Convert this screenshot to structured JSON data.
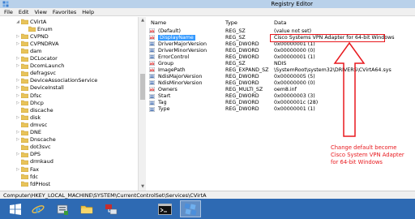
{
  "window": {
    "title": "Registry Editor"
  },
  "menu": [
    "File",
    "Edit",
    "View",
    "Favorites",
    "Help"
  ],
  "tree": [
    {
      "label": "CVirtA",
      "indent": 2,
      "expander": "◢",
      "open": true
    },
    {
      "label": "Enum",
      "indent": 3,
      "expander": "",
      "open": false
    },
    {
      "label": "CVPND",
      "indent": 2,
      "expander": "▷",
      "open": false
    },
    {
      "label": "CVPNDRVA",
      "indent": 2,
      "expander": "▷",
      "open": false
    },
    {
      "label": "dam",
      "indent": 2,
      "expander": "",
      "open": false
    },
    {
      "label": "DCLocator",
      "indent": 2,
      "expander": "▷",
      "open": false
    },
    {
      "label": "DcomLaunch",
      "indent": 2,
      "expander": "▷",
      "open": false
    },
    {
      "label": "defragsvc",
      "indent": 2,
      "expander": "",
      "open": false
    },
    {
      "label": "DeviceAssociationService",
      "indent": 2,
      "expander": "▷",
      "open": false
    },
    {
      "label": "DeviceInstall",
      "indent": 2,
      "expander": "▷",
      "open": false
    },
    {
      "label": "Dfsc",
      "indent": 2,
      "expander": "▷",
      "open": false
    },
    {
      "label": "Dhcp",
      "indent": 2,
      "expander": "▷",
      "open": false
    },
    {
      "label": "discache",
      "indent": 2,
      "expander": "",
      "open": false
    },
    {
      "label": "disk",
      "indent": 2,
      "expander": "▷",
      "open": false
    },
    {
      "label": "dmvsc",
      "indent": 2,
      "expander": "",
      "open": false
    },
    {
      "label": "DNE",
      "indent": 2,
      "expander": "▷",
      "open": false
    },
    {
      "label": "Dnscache",
      "indent": 2,
      "expander": "▷",
      "open": false
    },
    {
      "label": "dot3svc",
      "indent": 2,
      "expander": "",
      "open": false
    },
    {
      "label": "DPS",
      "indent": 2,
      "expander": "▷",
      "open": false
    },
    {
      "label": "drmkaud",
      "indent": 2,
      "expander": "",
      "open": false
    },
    {
      "label": "Fax",
      "indent": 2,
      "expander": "▷",
      "open": false
    },
    {
      "label": "fdc",
      "indent": 2,
      "expander": "",
      "open": false
    },
    {
      "label": "fdPHost",
      "indent": 2,
      "expander": "",
      "open": false
    }
  ],
  "list": {
    "headers": {
      "name": "Name",
      "type": "Type",
      "data": "Data"
    },
    "rows": [
      {
        "name": "(Default)",
        "type": "REG_SZ",
        "data": "(value not set)",
        "kind": "sz",
        "selected": false
      },
      {
        "name": "DisplayName",
        "type": "REG_SZ",
        "data": "Cisco Systems VPN Adapter for 64-bit Windows",
        "kind": "sz",
        "selected": true
      },
      {
        "name": "DriverMajorVersion",
        "type": "REG_DWORD",
        "data": "0x00000001 (1)",
        "kind": "dword",
        "selected": false
      },
      {
        "name": "DriverMinorVersion",
        "type": "REG_DWORD",
        "data": "0x00000000 (0)",
        "kind": "dword",
        "selected": false
      },
      {
        "name": "ErrorControl",
        "type": "REG_DWORD",
        "data": "0x00000001 (1)",
        "kind": "dword",
        "selected": false
      },
      {
        "name": "Group",
        "type": "REG_SZ",
        "data": "NDIS",
        "kind": "sz",
        "selected": false
      },
      {
        "name": "ImagePath",
        "type": "REG_EXPAND_SZ",
        "data": "\\SystemRoot\\system32\\DRIVERS\\CVirtA64.sys",
        "kind": "sz",
        "selected": false
      },
      {
        "name": "NdisMajorVersion",
        "type": "REG_DWORD",
        "data": "0x00000005 (5)",
        "kind": "dword",
        "selected": false
      },
      {
        "name": "NdisMinorVersion",
        "type": "REG_DWORD",
        "data": "0x00000000 (0)",
        "kind": "dword",
        "selected": false
      },
      {
        "name": "Owners",
        "type": "REG_MULTI_SZ",
        "data": "oem8.inf",
        "kind": "sz",
        "selected": false
      },
      {
        "name": "Start",
        "type": "REG_DWORD",
        "data": "0x00000003 (3)",
        "kind": "dword",
        "selected": false
      },
      {
        "name": "Tag",
        "type": "REG_DWORD",
        "data": "0x0000001c (28)",
        "kind": "dword",
        "selected": false
      },
      {
        "name": "Type",
        "type": "REG_DWORD",
        "data": "0x00000001 (1)",
        "kind": "dword",
        "selected": false
      }
    ]
  },
  "annotation": {
    "text": "Change default become Cisco System VPN Adapter for 64-bit Windows"
  },
  "statusbar": {
    "path": "Computer\\HKEY_LOCAL_MACHINE\\SYSTEM\\CurrentControlSet\\Services\\CVirtA"
  },
  "taskbar": {
    "items": [
      {
        "icon": "windows-start-icon",
        "active": false
      },
      {
        "icon": "internet-explorer-icon",
        "active": false
      },
      {
        "icon": "server-manager-icon",
        "active": false
      },
      {
        "icon": "file-explorer-icon",
        "active": false
      },
      {
        "icon": "network-icon",
        "active": false
      },
      {
        "icon": "command-prompt-icon",
        "active": false
      },
      {
        "icon": "registry-editor-icon",
        "active": true
      }
    ]
  },
  "colors": {
    "annotation": "#e8191e",
    "taskbar": "#2e6ab3",
    "selection": "#3399ff",
    "folder": "#e8c35a"
  }
}
